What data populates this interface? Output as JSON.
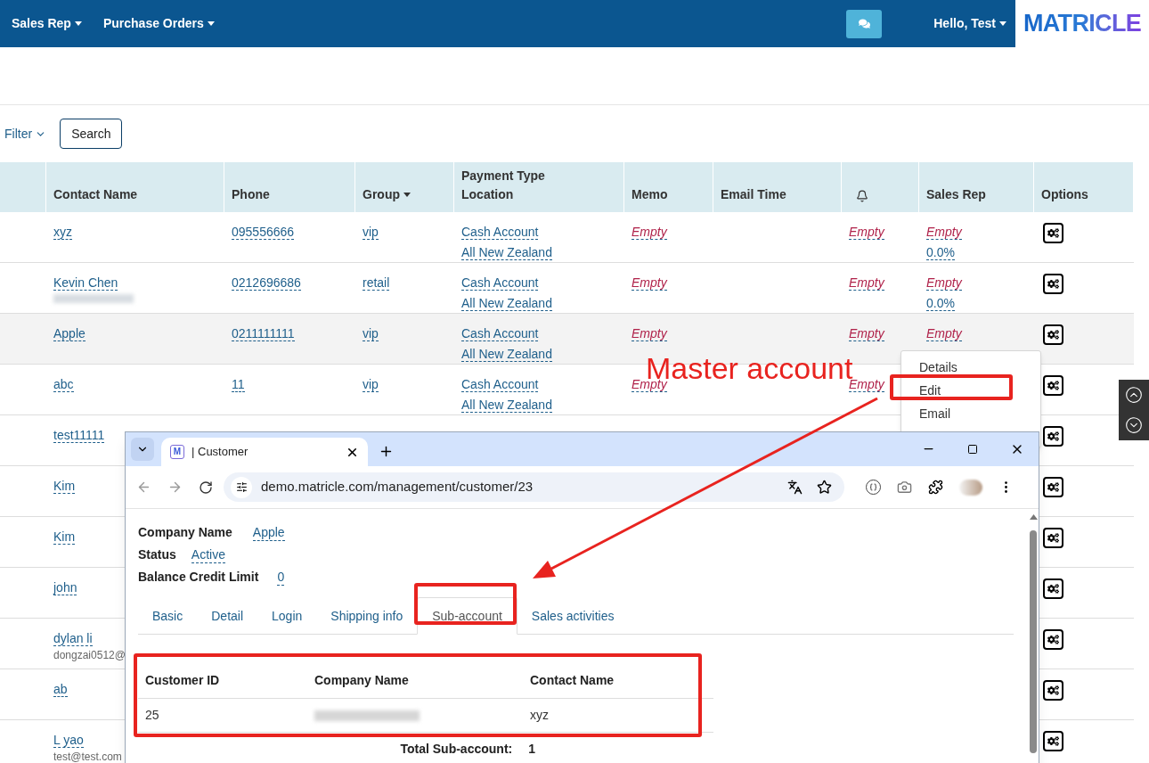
{
  "nav": {
    "menus": [
      {
        "label": "Sales Rep"
      },
      {
        "label": "Purchase Orders"
      }
    ],
    "greeting": "Hello, Test",
    "logo": "MATRICLE"
  },
  "toolbar": {
    "filter": "Filter",
    "search_button": "Search"
  },
  "table": {
    "columns": [
      {
        "label": "Contact Name"
      },
      {
        "label": "Phone"
      },
      {
        "label": "Group",
        "sortable": true
      },
      {
        "label": "Payment Type",
        "sublabel": "Location"
      },
      {
        "label": "Memo"
      },
      {
        "label": "Email Time"
      },
      {
        "kind": "bell"
      },
      {
        "label": "Sales Rep"
      },
      {
        "label": "Options"
      }
    ],
    "rows": [
      {
        "contact": "xyz",
        "phone": "095556666",
        "group": "vip",
        "payment": "Cash Account",
        "location": "All New Zealand",
        "memo": "Empty",
        "reminder": "Empty",
        "sales_rep": "Empty",
        "commission": "0.0%",
        "selected": false
      },
      {
        "contact": "Kevin Chen",
        "redacted_email": true,
        "phone": "0212696686",
        "group": "retail",
        "payment": "Cash Account",
        "location": "All New Zealand",
        "memo": "Empty",
        "reminder": "Empty",
        "sales_rep": "Empty",
        "commission": "0.0%",
        "selected": false
      },
      {
        "contact": "Apple",
        "phone": "0211111111",
        "group": "vip",
        "payment": "Cash Account",
        "location": "All New Zealand",
        "memo": "Empty",
        "reminder": "Empty",
        "sales_rep": "Empty",
        "selected": true
      },
      {
        "contact": "abc",
        "phone": "11",
        "group": "vip",
        "payment": "Cash Account",
        "location": "All New Zealand",
        "memo": "Empty",
        "reminder": "Empty",
        "selected": false
      },
      {
        "contact": "test11111",
        "selected": false
      },
      {
        "contact": "Kim",
        "selected": false
      },
      {
        "contact": "Kim",
        "selected": false
      },
      {
        "contact": "john",
        "selected": false
      },
      {
        "contact": "dylan li",
        "email": "dongzai0512@",
        "selected": false
      },
      {
        "contact": "ab",
        "selected": false
      },
      {
        "contact": "L yao",
        "email": "test@test.com",
        "selected": false
      }
    ]
  },
  "row_menu": {
    "items": [
      {
        "label": "Details"
      },
      {
        "label": "Edit"
      },
      {
        "label": "Email"
      }
    ]
  },
  "annotation": {
    "text": "Master account"
  },
  "browser": {
    "favicon": "M",
    "tab_title": "| Customer",
    "url": "demo.matricle.com/management/customer/23",
    "fields": [
      {
        "label": "Company Name",
        "value": "Apple"
      },
      {
        "label": "Status",
        "value": "Active"
      },
      {
        "label": "Balance Credit Limit",
        "value": "0"
      }
    ],
    "tabs": [
      {
        "label": "Basic",
        "selected": false
      },
      {
        "label": "Detail",
        "selected": false
      },
      {
        "label": "Login",
        "selected": false
      },
      {
        "label": "Shipping info",
        "selected": false
      },
      {
        "label": "Sub-account",
        "selected": true
      },
      {
        "label": "Sales activities",
        "selected": false
      }
    ],
    "sub_table": {
      "columns": [
        "Customer ID",
        "Company Name",
        "Contact Name"
      ],
      "rows": [
        {
          "customer_id": "25",
          "company_redacted": true,
          "contact": "xyz"
        }
      ]
    },
    "total": {
      "label": "Total Sub-account:",
      "value": "1"
    }
  }
}
